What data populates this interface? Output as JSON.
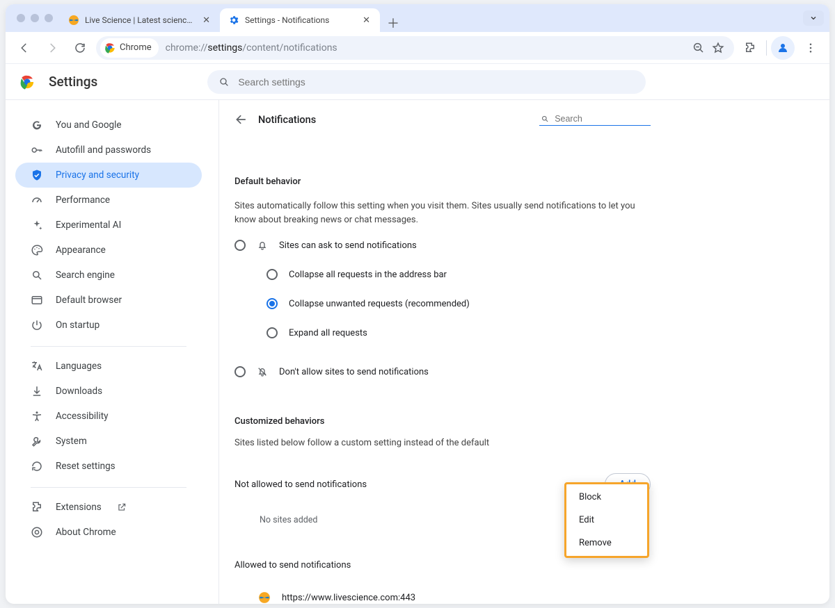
{
  "tabs": [
    {
      "title": "Live Science | Latest science …",
      "active": false
    },
    {
      "title": "Settings - Notifications",
      "active": true
    }
  ],
  "toolbar": {
    "chip_label": "Chrome",
    "url_dim1": "chrome://",
    "url_strong": "settings",
    "url_dim2": "/content/notifications"
  },
  "settings_header": {
    "title": "Settings",
    "search_placeholder": "Search settings"
  },
  "sidebar": {
    "items": [
      "You and Google",
      "Autofill and passwords",
      "Privacy and security",
      "Performance",
      "Experimental AI",
      "Appearance",
      "Search engine",
      "Default browser",
      "On startup"
    ],
    "items2": [
      "Languages",
      "Downloads",
      "Accessibility",
      "System",
      "Reset settings"
    ],
    "items3": [
      "Extensions",
      "About Chrome"
    ],
    "selected_index": 2
  },
  "panel": {
    "title": "Notifications",
    "search_placeholder": "Search",
    "default_behavior_title": "Default behavior",
    "default_behavior_desc": "Sites automatically follow this setting when you visit them. Sites usually send notifications to let you know about breaking news or chat messages.",
    "radio_ask": "Sites can ask to send notifications",
    "radio_collapse_addr": "Collapse all requests in the address bar",
    "radio_collapse_rec": "Collapse unwanted requests (recommended)",
    "radio_expand": "Expand all requests",
    "radio_dont_allow": "Don't allow sites to send notifications",
    "custom_title": "Customized behaviors",
    "custom_desc": "Sites listed below follow a custom setting instead of the default",
    "not_allowed_label": "Not allowed to send notifications",
    "add_button": "Add",
    "no_sites": "No sites added",
    "allowed_label": "Allowed to send notifications",
    "allowed_site": "https://www.livescience.com:443"
  },
  "context_menu": {
    "items": [
      "Block",
      "Edit",
      "Remove"
    ]
  }
}
